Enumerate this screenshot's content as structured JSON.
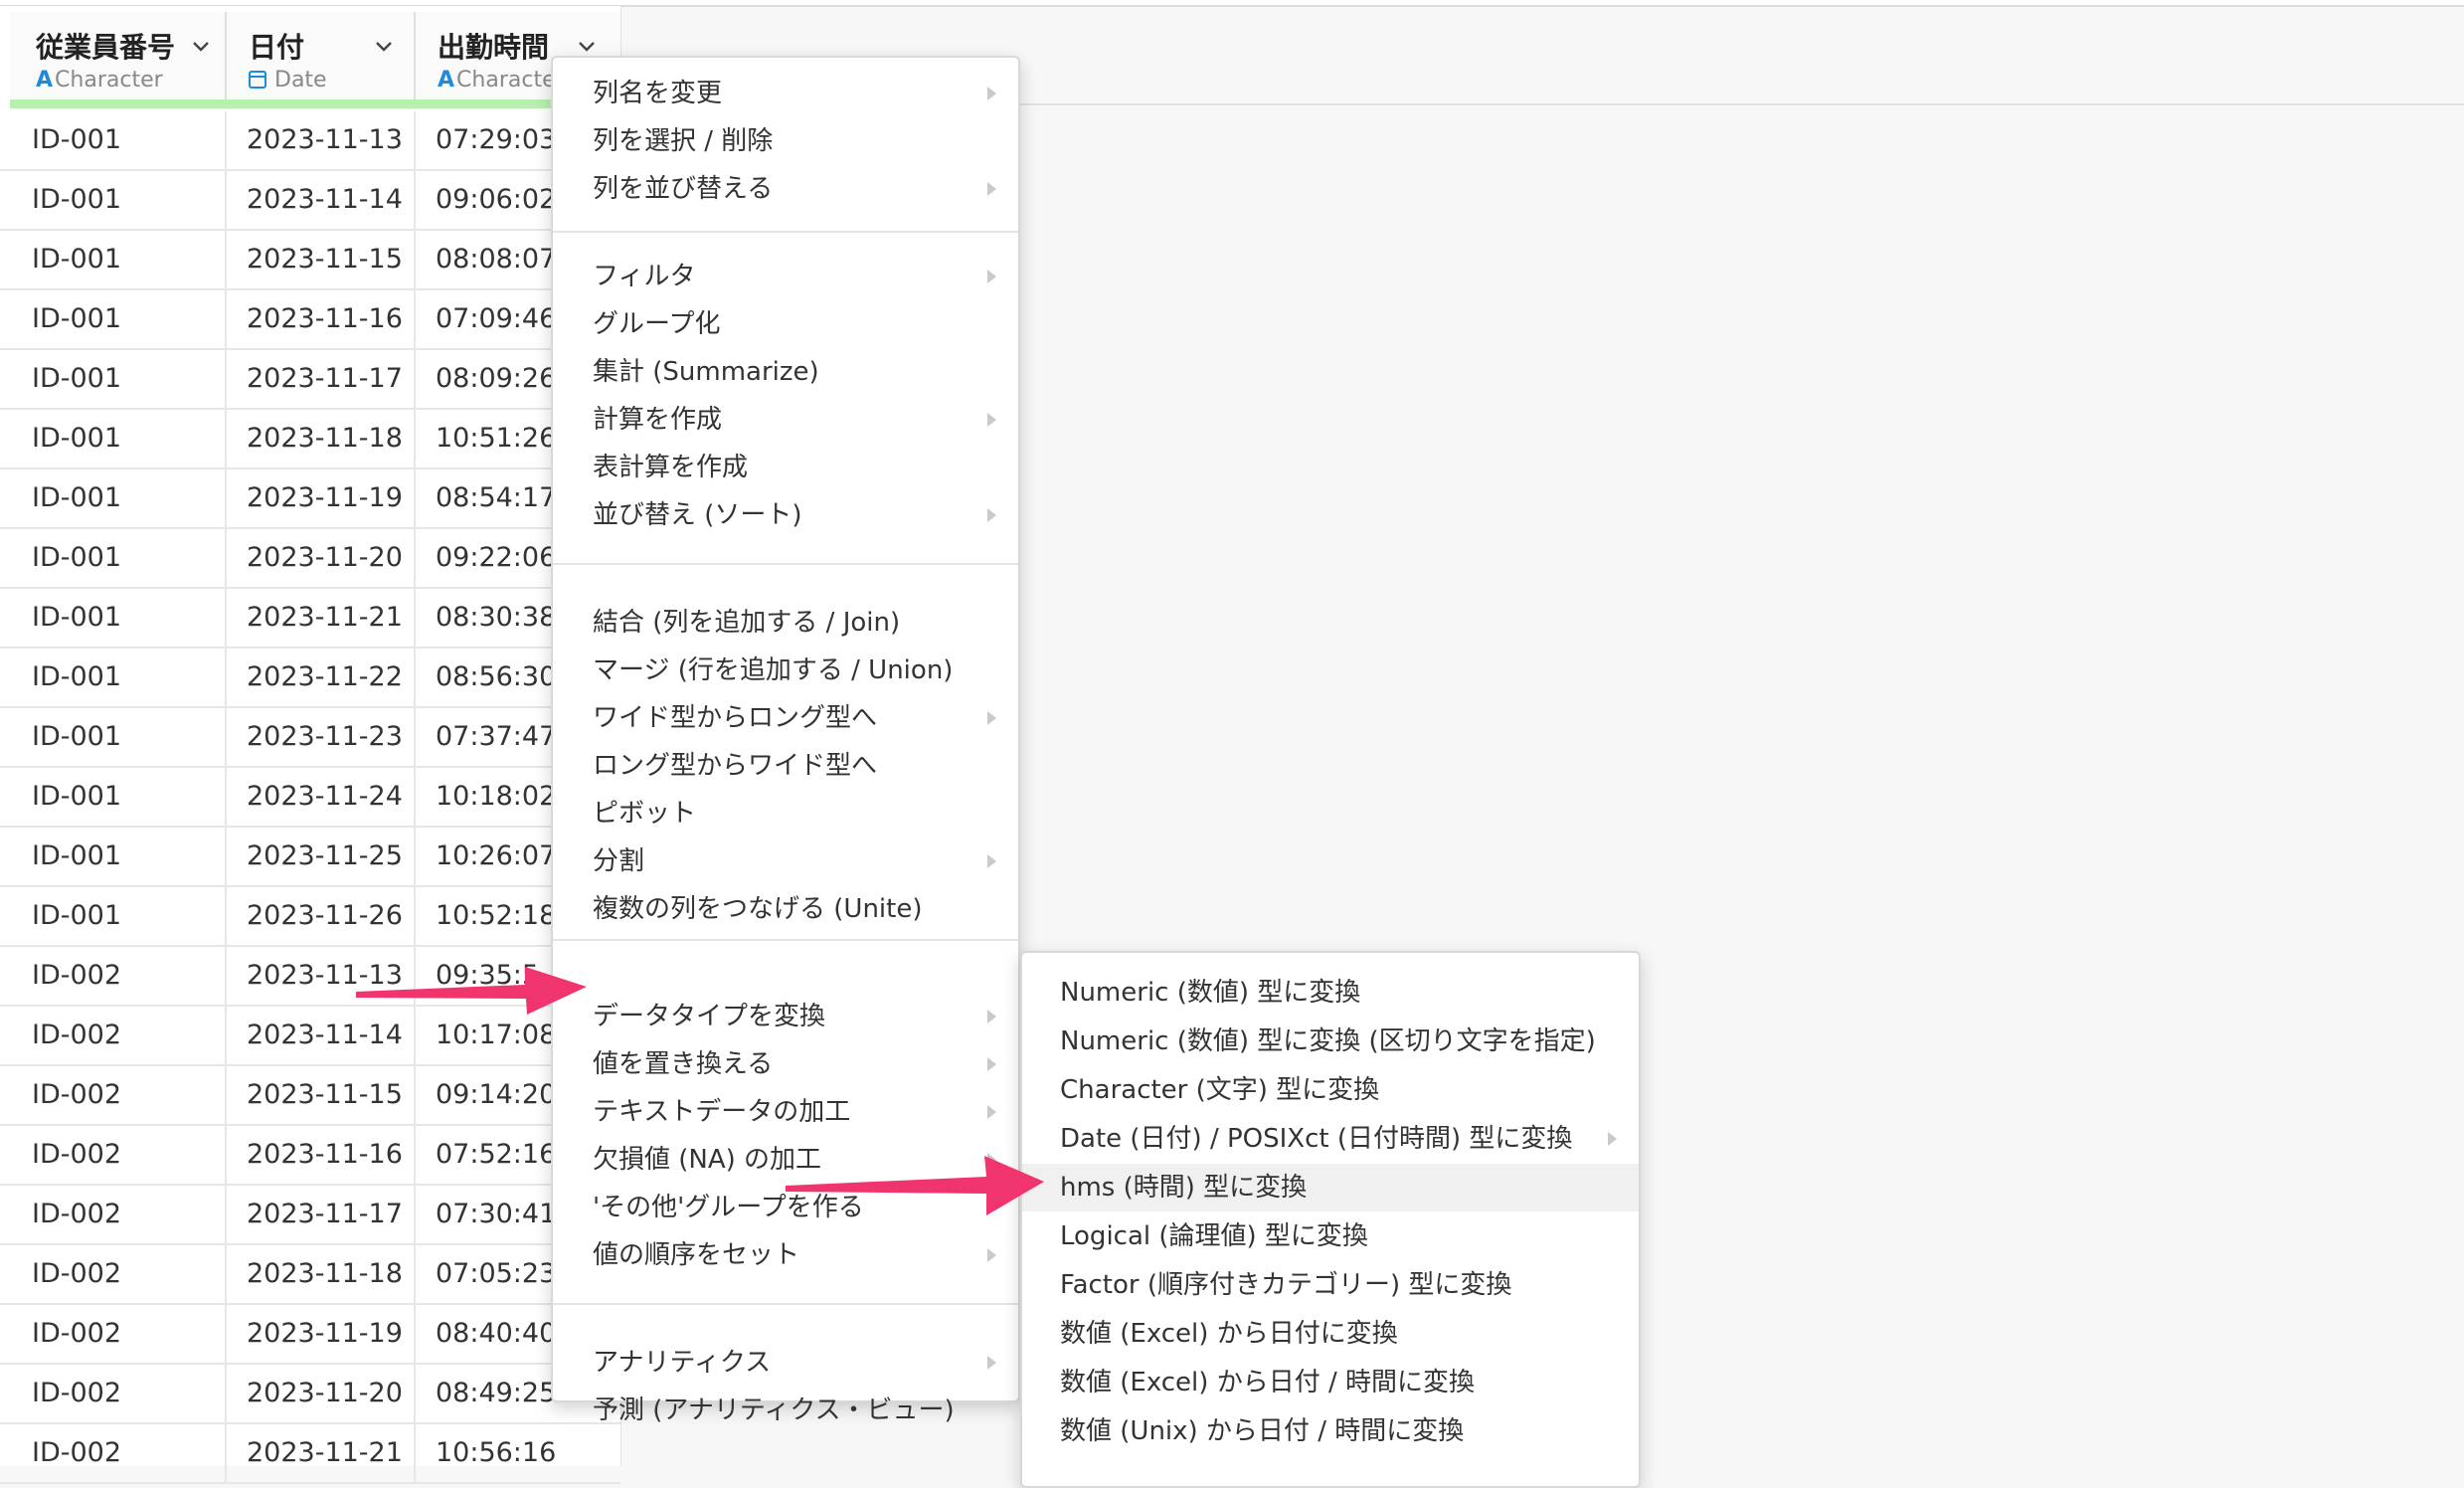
{
  "columns": [
    {
      "name": "従業員番号",
      "type": "Character"
    },
    {
      "name": "日付",
      "type": "Date"
    },
    {
      "name": "出勤時間",
      "type": "Characte"
    }
  ],
  "rows": [
    [
      "ID-001",
      "2023-11-13",
      "07:29:03"
    ],
    [
      "ID-001",
      "2023-11-14",
      "09:06:02"
    ],
    [
      "ID-001",
      "2023-11-15",
      "08:08:07"
    ],
    [
      "ID-001",
      "2023-11-16",
      "07:09:46"
    ],
    [
      "ID-001",
      "2023-11-17",
      "08:09:26"
    ],
    [
      "ID-001",
      "2023-11-18",
      "10:51:26"
    ],
    [
      "ID-001",
      "2023-11-19",
      "08:54:17"
    ],
    [
      "ID-001",
      "2023-11-20",
      "09:22:06"
    ],
    [
      "ID-001",
      "2023-11-21",
      "08:30:38"
    ],
    [
      "ID-001",
      "2023-11-22",
      "08:56:30"
    ],
    [
      "ID-001",
      "2023-11-23",
      "07:37:47"
    ],
    [
      "ID-001",
      "2023-11-24",
      "10:18:02"
    ],
    [
      "ID-001",
      "2023-11-25",
      "10:26:07"
    ],
    [
      "ID-001",
      "2023-11-26",
      "10:52:18"
    ],
    [
      "ID-002",
      "2023-11-13",
      "09:35:5"
    ],
    [
      "ID-002",
      "2023-11-14",
      "10:17:08"
    ],
    [
      "ID-002",
      "2023-11-15",
      "09:14:20"
    ],
    [
      "ID-002",
      "2023-11-16",
      "07:52:16"
    ],
    [
      "ID-002",
      "2023-11-17",
      "07:30:41"
    ],
    [
      "ID-002",
      "2023-11-18",
      "07:05:23"
    ],
    [
      "ID-002",
      "2023-11-19",
      "08:40:40"
    ],
    [
      "ID-002",
      "2023-11-20",
      "08:49:25"
    ],
    [
      "ID-002",
      "2023-11-21",
      "10:56:16"
    ]
  ],
  "menu": {
    "items": [
      {
        "label": "列名を変更",
        "submenu": true
      },
      {
        "label": "列を選択 / 削除",
        "submenu": false
      },
      {
        "label": "列を並び替える",
        "submenu": true
      },
      {
        "label": "フィルタ",
        "submenu": true
      },
      {
        "label": "グループ化",
        "submenu": false
      },
      {
        "label": "集計 (Summarize)",
        "submenu": false
      },
      {
        "label": "計算を作成",
        "submenu": true
      },
      {
        "label": "表計算を作成",
        "submenu": false
      },
      {
        "label": "並び替え (ソート)",
        "submenu": true
      },
      {
        "label": "結合 (列を追加する / Join)",
        "submenu": false
      },
      {
        "label": "マージ (行を追加する / Union)",
        "submenu": false
      },
      {
        "label": "ワイド型からロング型へ",
        "submenu": true
      },
      {
        "label": "ロング型からワイド型へ",
        "submenu": false
      },
      {
        "label": "ピボット",
        "submenu": false
      },
      {
        "label": "分割",
        "submenu": true
      },
      {
        "label": "複数の列をつなげる (Unite)",
        "submenu": false
      },
      {
        "label": "データタイプを変換",
        "submenu": true
      },
      {
        "label": "値を置き換える",
        "submenu": true
      },
      {
        "label": "テキストデータの加工",
        "submenu": true
      },
      {
        "label": "欠損値 (NA) の加工",
        "submenu": true
      },
      {
        "label": "'その他'グループを作る",
        "submenu": false
      },
      {
        "label": "値の順序をセット",
        "submenu": true
      },
      {
        "label": "アナリティクス",
        "submenu": true
      },
      {
        "label": "予測 (アナリティクス・ビュー)",
        "submenu": false
      }
    ]
  },
  "submenu": {
    "items": [
      {
        "label": "Numeric (数値) 型に変換",
        "submenu": false
      },
      {
        "label": "Numeric (数値) 型に変換 (区切り文字を指定)",
        "submenu": false
      },
      {
        "label": "Character (文字) 型に変換",
        "submenu": false
      },
      {
        "label": "Date (日付) / POSIXct (日付時間) 型に変換",
        "submenu": true
      },
      {
        "label": "hms (時間) 型に変換",
        "submenu": false,
        "active": true
      },
      {
        "label": "Logical (論理値) 型に変換",
        "submenu": false
      },
      {
        "label": "Factor (順序付きカテゴリー) 型に変換",
        "submenu": false
      },
      {
        "label": "数値 (Excel) から日付に変換",
        "submenu": false
      },
      {
        "label": "数値 (Excel) から日付 / 時間に変換",
        "submenu": false
      },
      {
        "label": "数値 (Unix) から日付 / 時間に変換",
        "submenu": false
      }
    ]
  },
  "colors": {
    "accent": "#1e8bd6",
    "arrow": "#f0346e",
    "column_bar": "#b8f0b0"
  }
}
